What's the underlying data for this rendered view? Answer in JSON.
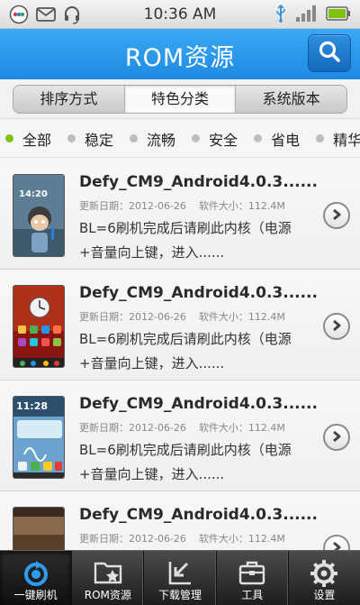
{
  "status_bar": {
    "time": "10:36 AM",
    "left_icons": [
      "app-badge-icon",
      "mail-icon",
      "headset-icon"
    ],
    "right_icons": [
      "usb-icon",
      "signal-icon",
      "battery-icon"
    ]
  },
  "header": {
    "title": "ROM资源",
    "search_icon": "search-icon"
  },
  "tabs": [
    {
      "label": "排序方式",
      "active": false
    },
    {
      "label": "特色分类",
      "active": true
    },
    {
      "label": "系统版本",
      "active": false
    }
  ],
  "filters": [
    {
      "label": "全部",
      "active": true
    },
    {
      "label": "稳定",
      "active": false
    },
    {
      "label": "流畅",
      "active": false
    },
    {
      "label": "安全",
      "active": false
    },
    {
      "label": "省电",
      "active": false
    },
    {
      "label": "精华",
      "active": false
    }
  ],
  "roms": [
    {
      "title": "Defy_CM9_Android4.0.3......",
      "date_label": "更新日期：2012-06-26",
      "size_label": "软件大小：112.4M",
      "desc": "BL=6刷机完成后请刷此内核（电源+音量向上键，进入......",
      "thumb_time": "14:20"
    },
    {
      "title": "Defy_CM9_Android4.0.3......",
      "date_label": "更新日期：2012-06-26",
      "size_label": "软件大小：112.4M",
      "desc": "BL=6刷机完成后请刷此内核（电源+音量向上键，进入......",
      "thumb_time": ""
    },
    {
      "title": "Defy_CM9_Android4.0.3......",
      "date_label": "更新日期：2012-06-26",
      "size_label": "软件大小：112.4M",
      "desc": "BL=6刷机完成后请刷此内核（电源+音量向上键，进入......",
      "thumb_time": "11:28"
    },
    {
      "title": "Defy_CM9_Android4.0.3......",
      "date_label": "更新日期：2012-06-26",
      "size_label": "软件大小：112.4M",
      "desc": "",
      "thumb_time": ""
    }
  ],
  "bottom_nav": [
    {
      "label": "一键刷机",
      "icon": "refresh-icon",
      "active": true
    },
    {
      "label": "ROM资源",
      "icon": "star-folder-icon",
      "active": false
    },
    {
      "label": "下载管理",
      "icon": "download-icon",
      "active": false
    },
    {
      "label": "工具",
      "icon": "toolbox-icon",
      "active": false
    },
    {
      "label": "设置",
      "icon": "gear-icon",
      "active": false
    }
  ],
  "colors": {
    "header_blue": "#2596ea",
    "active_dot": "#7ec10e",
    "nav_dark": "#2a2a2a"
  }
}
